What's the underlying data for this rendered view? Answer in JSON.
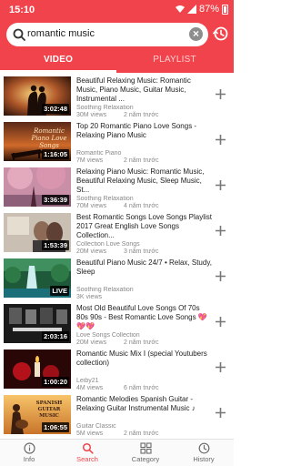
{
  "status": {
    "time": "15:10",
    "battery": "87%"
  },
  "search": {
    "query": "romantic music"
  },
  "tabs": [
    {
      "label": "VIDEO"
    },
    {
      "label": "PLAYLIST"
    }
  ],
  "videos": [
    {
      "title": "Beautiful Relaxing Music: Romantic Music, Piano Music, Guitar Music, Instrumental ...",
      "channel": "Soothing Relaxation",
      "views": "30M views",
      "ago": "2 năm trước",
      "duration": "3:02:48"
    },
    {
      "title": "Top 20 Romantic Piano Love Songs - Relaxing Piano Music",
      "channel": "Romantic Piano",
      "views": "7M views",
      "ago": "2 năm trước",
      "duration": "1:16:05",
      "thumb_text": "Romantic Piano Love Songs"
    },
    {
      "title": "Relaxing Piano Music: Romantic Music, Beautiful Relaxing Music, Sleep Music, St...",
      "channel": "Soothing Relaxation",
      "views": "70M views",
      "ago": "4 năm trước",
      "duration": "3:36:39"
    },
    {
      "title": "Best Romantic Songs Love Songs Playlist 2017 Great English Love Songs Collection...",
      "channel": "Collection Love Songs",
      "views": "20M views",
      "ago": "3 năm trước",
      "duration": "1:53:39"
    },
    {
      "title": "Beautiful Piano Music 24/7 • Relax, Study, Sleep",
      "channel": "Soothing Relaxation",
      "views": "3K views",
      "ago": "",
      "duration": "LIVE"
    },
    {
      "title": "Most Old Beautiful Love Songs Of 70s 80s 90s - Best Romantic Love Songs 💖💖💖",
      "channel": "Love Songs Collection",
      "views": "20M views",
      "ago": "2 năm trước",
      "duration": "2:03:16"
    },
    {
      "title": "Romantic Music Mix Ⅰ (special Youtubers collection)",
      "channel": "Leiby21",
      "views": "4M views",
      "ago": "6 năm trước",
      "duration": "1:00:20"
    },
    {
      "title": "Romantic Melodies Spanish Guitar - Relaxing Guitar Instrumental Music ♪",
      "channel": "Guitar Classic",
      "views": "5M views",
      "ago": "2 năm trước",
      "duration": "1:06:55",
      "thumb_text": "SPANISH GUITAR MUSIC"
    }
  ],
  "nav": [
    {
      "label": "Info",
      "icon": "info-icon"
    },
    {
      "label": "Search",
      "icon": "search-icon"
    },
    {
      "label": "Category",
      "icon": "grid-icon"
    },
    {
      "label": "History",
      "icon": "clock-icon"
    }
  ],
  "colors": {
    "accent": "#f1434b"
  }
}
